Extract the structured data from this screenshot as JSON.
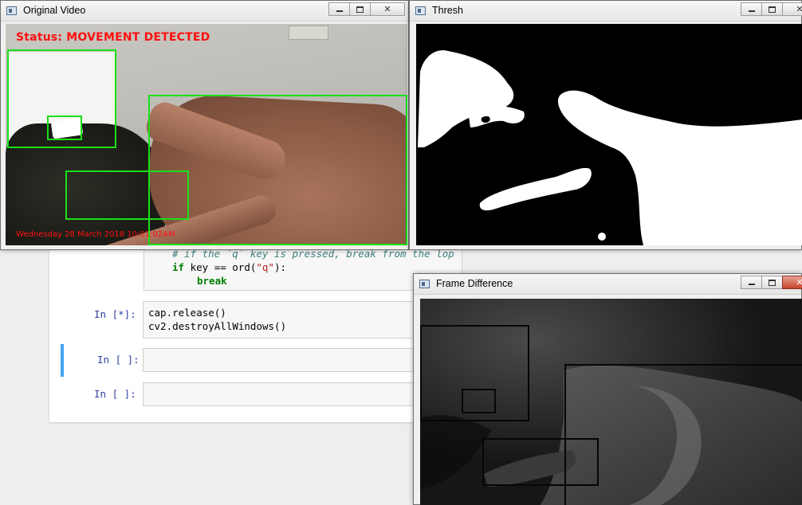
{
  "notebook": {
    "code_cell": {
      "comment_line": "# if the `q` key is pressed, break from the lop",
      "if_keyword": "if",
      "if_expr": " key == ord(",
      "if_string": "\"q\"",
      "if_close": "):",
      "break_keyword": "break"
    },
    "cells": [
      {
        "prompt": "In [*]:",
        "lines": [
          "cap.release()",
          "cv2.destroyAllWindows()"
        ]
      },
      {
        "prompt": "In [ ]:",
        "lines": [
          ""
        ]
      },
      {
        "prompt": "In [ ]:",
        "lines": [
          ""
        ]
      }
    ]
  },
  "windows": {
    "original": {
      "title": "Original Video",
      "status_overlay": "Status: MOVEMENT DETECTED",
      "timestamp_overlay": "Wednesday 28 March 2018 10:01:02AM"
    },
    "thresh": {
      "title": "Thresh"
    },
    "frame_difference": {
      "title": "Frame Difference"
    }
  },
  "colors": {
    "detection_box": "#19e019",
    "status_text": "#ff1010",
    "selected_cell_bar": "#42a5f5",
    "close_button_active": "#c7432c"
  },
  "icons": {
    "window_app": "opencv-window-icon",
    "minimize": "minimize-icon",
    "maximize": "maximize-icon",
    "close": "close-icon"
  }
}
